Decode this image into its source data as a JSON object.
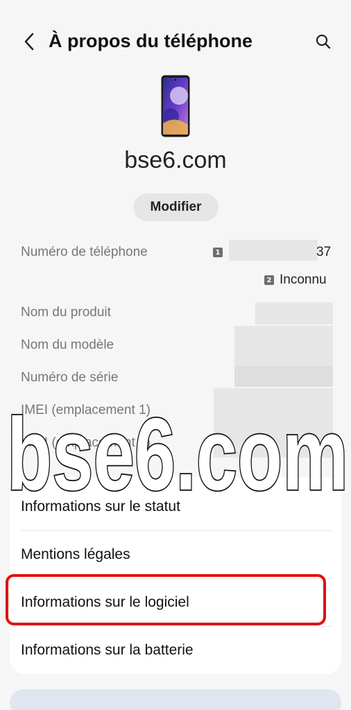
{
  "header": {
    "title": "À propos du téléphone",
    "back_icon": "chevron-left-icon",
    "search_icon": "search-icon"
  },
  "device": {
    "name": "bse6.com",
    "modify_label": "Modifier"
  },
  "info": {
    "phone_label": "Numéro de téléphone",
    "sim1_badge": "1",
    "sim1_suffix": "37",
    "sim2_badge": "2",
    "sim2_value": "Inconnu",
    "product_label": "Nom du produit",
    "model_label": "Nom du modèle",
    "serial_label": "Numéro de série",
    "imei1_label": "IMEI (emplacement 1)",
    "imei2_label": "IMEI (emplacement 2)"
  },
  "menu": {
    "status": "Informations sur le statut",
    "legal": "Mentions légales",
    "software": "Informations sur le logiciel",
    "battery": "Informations sur la batterie"
  },
  "watermark": "bse6.com",
  "colors": {
    "highlight": "#e01212",
    "background": "#f6f6f6"
  }
}
